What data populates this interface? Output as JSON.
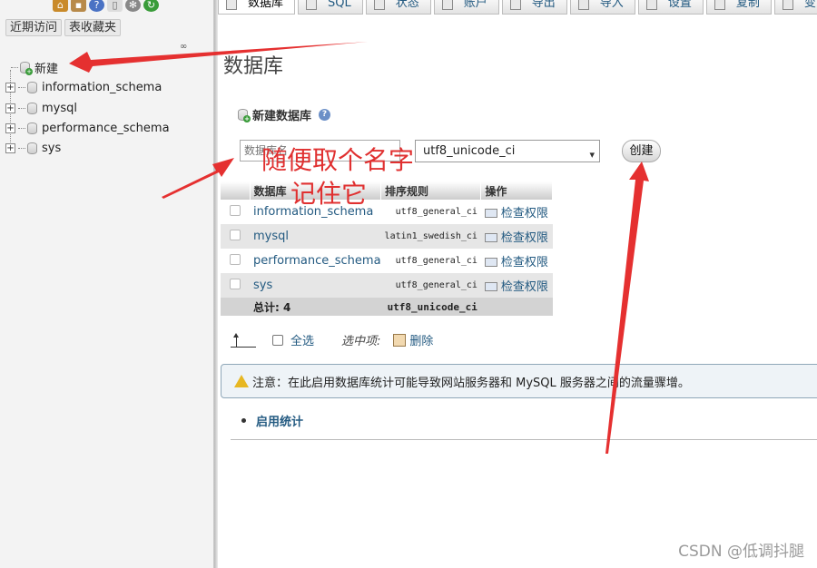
{
  "sidebar": {
    "recent_button": "近期访问",
    "favorites_button": "表收藏夹",
    "link_glyph": "∞",
    "new_item": "新建",
    "databases": [
      "information_schema",
      "mysql",
      "performance_schema",
      "sys"
    ]
  },
  "tabs": [
    "数据库",
    "SQL",
    "状态",
    "账户",
    "导出",
    "导入",
    "设置",
    "复制",
    "变"
  ],
  "main": {
    "title": "数据库",
    "new_db_heading": "新建数据库",
    "name_placeholder": "数据库名",
    "collation_value": "utf8_unicode_ci",
    "create_button": "创建"
  },
  "table": {
    "headers": {
      "name": "数据库",
      "collation": "排序规则",
      "action": "操作"
    },
    "rows": [
      {
        "name": "information_schema",
        "collation": "utf8_general_ci",
        "action": "检查权限"
      },
      {
        "name": "mysql",
        "collation": "latin1_swedish_ci",
        "action": "检查权限"
      },
      {
        "name": "performance_schema",
        "collation": "utf8_general_ci",
        "action": "检查权限"
      },
      {
        "name": "sys",
        "collation": "utf8_general_ci",
        "action": "检查权限"
      }
    ],
    "total_label": "总计: 4",
    "total_collation": "utf8_unicode_ci"
  },
  "bulk": {
    "select_all": "全选",
    "with_selected": "选中项:",
    "delete": "删除"
  },
  "notice": "注意：在此启用数据库统计可能导致网站服务器和 MySQL 服务器之间的流量骤增。",
  "stats_link": "启用统计",
  "annotations": {
    "line1": "随便取个名字",
    "line2": "记住它",
    "color": "#e03030"
  },
  "watermark": "CSDN @低调抖腿"
}
